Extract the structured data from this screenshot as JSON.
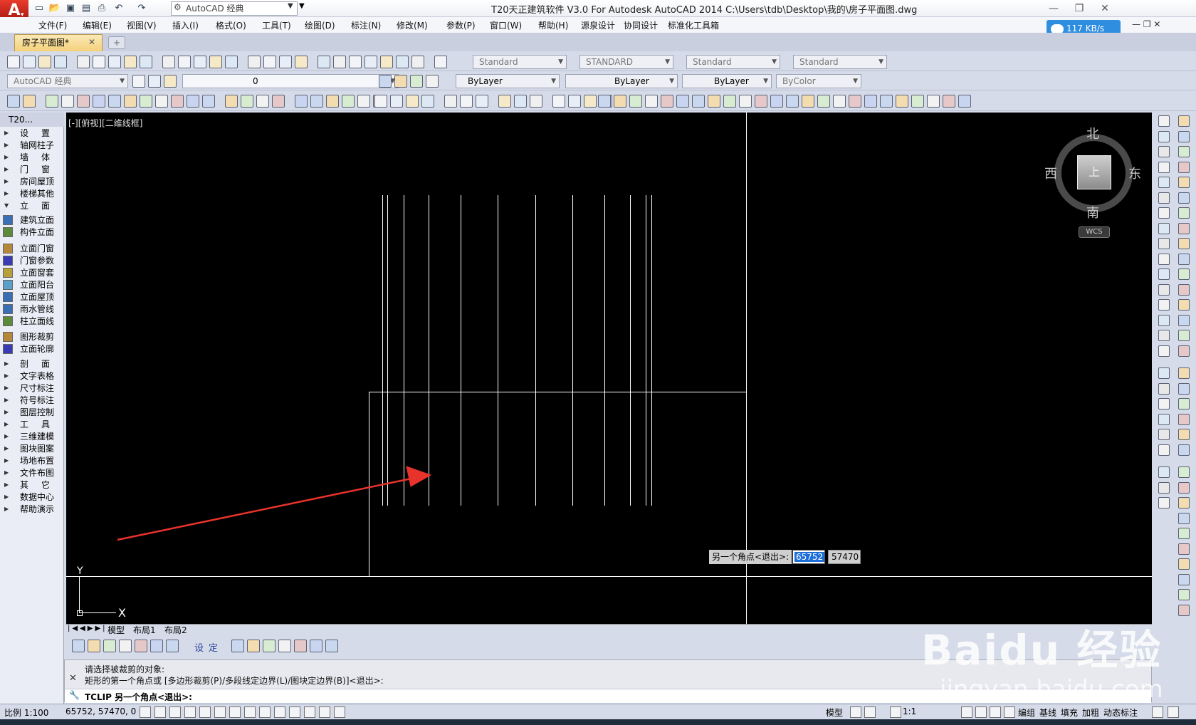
{
  "window": {
    "title": "T20天正建筑软件 V3.0 For Autodesk AutoCAD 2014    C:\\Users\\tdb\\Desktop\\我的\\房子平面图.dwg",
    "workspace": "AutoCAD 经典"
  },
  "menu": [
    "文件(F)",
    "编辑(E)",
    "视图(V)",
    "插入(I)",
    "格式(O)",
    "工具(T)",
    "绘图(D)",
    "标注(N)",
    "修改(M)",
    "参数(P)",
    "窗口(W)",
    "帮助(H)",
    "源泉设计",
    "协同设计",
    "标准化工具箱"
  ],
  "network_speed": "117 KB/s",
  "doc_tab": "房子平面图*",
  "toolbar_styles": {
    "text_style": "Standard",
    "dim_style": "STANDARD",
    "table_style": "Standard",
    "multileader_style": "Standard"
  },
  "layer_toolbar": {
    "workspace": "AutoCAD 经典",
    "layer": "0",
    "color": "ByLayer",
    "linetype": "ByLayer",
    "lineweight": "ByLayer",
    "plotstyle": "ByColor"
  },
  "palette": {
    "title": "T20...",
    "items": [
      {
        "label": "设置",
        "type": "folder",
        "spread": true
      },
      {
        "label": "轴网柱子",
        "type": "folder"
      },
      {
        "label": "墙体",
        "type": "folder",
        "spread": true
      },
      {
        "label": "门窗",
        "type": "folder",
        "spread": true
      },
      {
        "label": "房间屋顶",
        "type": "folder"
      },
      {
        "label": "楼梯其他",
        "type": "folder"
      },
      {
        "label": "立面",
        "type": "open",
        "spread": true
      },
      {
        "label": "建筑立面",
        "type": "tool"
      },
      {
        "label": "构件立面",
        "type": "tool"
      },
      {
        "label": "立面门窗",
        "type": "tool"
      },
      {
        "label": "门窗参数",
        "type": "tool"
      },
      {
        "label": "立面窗套",
        "type": "tool"
      },
      {
        "label": "立面阳台",
        "type": "tool"
      },
      {
        "label": "立面屋顶",
        "type": "tool"
      },
      {
        "label": "雨水管线",
        "type": "tool"
      },
      {
        "label": "柱立面线",
        "type": "tool"
      },
      {
        "label": "图形裁剪",
        "type": "tool"
      },
      {
        "label": "立面轮廓",
        "type": "tool"
      },
      {
        "label": "剖面",
        "type": "folder",
        "spread": true
      },
      {
        "label": "文字表格",
        "type": "folder"
      },
      {
        "label": "尺寸标注",
        "type": "folder"
      },
      {
        "label": "符号标注",
        "type": "folder"
      },
      {
        "label": "图层控制",
        "type": "folder"
      },
      {
        "label": "工具",
        "type": "folder",
        "spread": true
      },
      {
        "label": "三维建模",
        "type": "folder"
      },
      {
        "label": "图块图案",
        "type": "folder"
      },
      {
        "label": "场地布置",
        "type": "folder"
      },
      {
        "label": "文件布图",
        "type": "folder"
      },
      {
        "label": "其它",
        "type": "folder",
        "spread": true
      },
      {
        "label": "数据中心",
        "type": "folder"
      },
      {
        "label": "帮助演示",
        "type": "folder"
      }
    ]
  },
  "viewport": {
    "label": "[-][俯视][二维线框]",
    "viewcube": {
      "north": "北",
      "south": "南",
      "east": "东",
      "west": "西",
      "face": "上",
      "wcs": "WCS"
    },
    "ucs": {
      "x": "X",
      "y": "Y"
    },
    "prompt": "另一个角点<退出>:",
    "input_x": "65752",
    "input_y": "57470"
  },
  "layout_tabs": [
    "模型",
    "布局1",
    "布局2"
  ],
  "bottom_strip_text": [
    "设",
    "定"
  ],
  "command": {
    "history": [
      "请选择被裁剪的对象:",
      "矩形的第一个角点或 [多边形裁剪(P)/多段线定边界(L)/图块定边界(B)]<退出>:"
    ],
    "current": "TCLIP 另一个角点<退出>:"
  },
  "status": {
    "scale": "比例 1:100",
    "coords": "65752, 57470, 0",
    "model": "模型",
    "anno_scale": "1:1",
    "right_items": [
      "编组",
      "基线",
      "填充",
      "加粗",
      "动态标注"
    ]
  },
  "watermark": {
    "logo": "Baidu 经验",
    "url": "jingyan.baidu.com"
  },
  "colors": {
    "canvas": "#000000",
    "lines": "#ffffff",
    "arrow": "#e8332c",
    "accent": "#2f8ee0"
  }
}
